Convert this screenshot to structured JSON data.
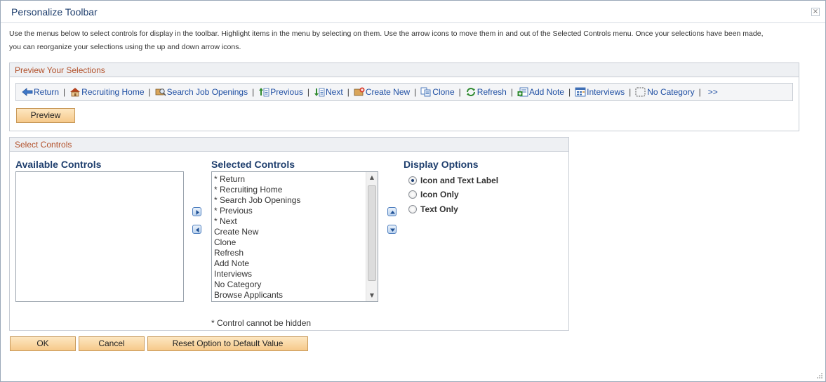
{
  "dialog": {
    "title": "Personalize Toolbar",
    "close_glyph": "×",
    "instructions": "Use the menus below to select controls for display in the toolbar. Highlight items in the menu by selecting on them. Use the arrow icons to move them in and out of the Selected Controls menu. Once your selections have been made, you can reorganize your selections using the up and down arrow icons."
  },
  "preview_section": {
    "header": "Preview Your Selections",
    "toolbar_items": [
      {
        "label": "Return",
        "icon": "back-arrow-icon"
      },
      {
        "label": "Recruiting Home",
        "icon": "home-icon"
      },
      {
        "label": "Search Job Openings",
        "icon": "search-icon"
      },
      {
        "label": "Previous",
        "icon": "previous-icon"
      },
      {
        "label": "Next",
        "icon": "next-icon"
      },
      {
        "label": "Create New",
        "icon": "create-new-icon"
      },
      {
        "label": "Clone",
        "icon": "clone-icon"
      },
      {
        "label": "Refresh",
        "icon": "refresh-icon"
      },
      {
        "label": "Add Note",
        "icon": "add-note-icon"
      },
      {
        "label": "Interviews",
        "icon": "interviews-icon"
      },
      {
        "label": "No Category",
        "icon": "no-category-icon"
      }
    ],
    "separator": "|",
    "more_label": ">>",
    "preview_button": "Preview"
  },
  "select_section": {
    "header": "Select Controls",
    "available_title": "Available Controls",
    "available_items": [],
    "selected_title": "Selected Controls",
    "selected_items": [
      "* Return",
      "* Recruiting Home",
      "* Search Job Openings",
      "* Previous",
      "* Next",
      "Create New",
      "Clone",
      "Refresh",
      "Add Note",
      "Interviews",
      "No Category",
      "Browse Applicants"
    ],
    "display_title": "Display Options",
    "display_options": [
      {
        "label": "Icon and Text Label",
        "checked": true
      },
      {
        "label": "Icon Only",
        "checked": false
      },
      {
        "label": "Text Only",
        "checked": false
      }
    ],
    "footnote": "* Control cannot be hidden"
  },
  "footer": {
    "ok": "OK",
    "cancel": "Cancel",
    "reset": "Reset Option to Default Value"
  },
  "colors": {
    "title_blue": "#1f3f6e",
    "link_blue": "#1f4fa3",
    "section_orange": "#b2512b",
    "button_fill": "#f6c98a"
  }
}
